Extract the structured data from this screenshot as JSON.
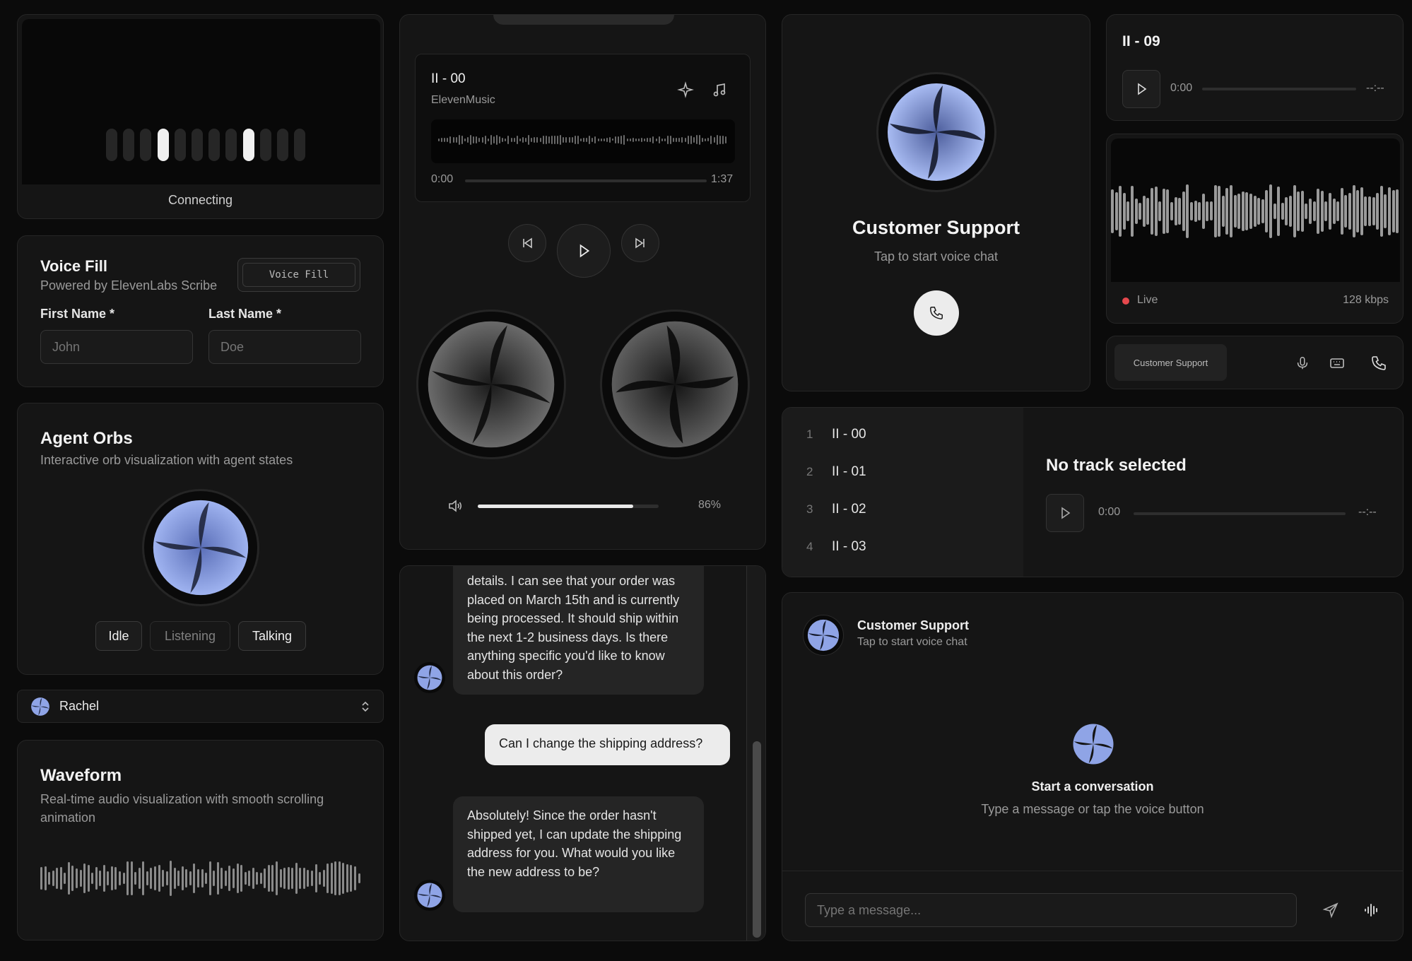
{
  "connecting": {
    "status": "Connecting",
    "bars": [
      0.8,
      0.8,
      0.8,
      0.8,
      0.8,
      0.8,
      0.8,
      0.8,
      0.8,
      0.8,
      0.8,
      0.8
    ],
    "active": [
      3,
      8
    ]
  },
  "voice_fill": {
    "title": "Voice Fill",
    "subtitle": "Powered by ElevenLabs Scribe",
    "button": "Voice Fill",
    "first_label": "First Name *",
    "first_placeholder": "John",
    "last_label": "Last Name *",
    "last_placeholder": "Doe"
  },
  "agent_orbs": {
    "title": "Agent Orbs",
    "subtitle": "Interactive orb visualization with agent states",
    "states": [
      "Idle",
      "Listening",
      "Talking"
    ]
  },
  "voice_select": {
    "value": "Rachel"
  },
  "waveform": {
    "title": "Waveform",
    "subtitle": "Real-time audio visualization with smooth scrolling animation"
  },
  "music": {
    "track": "II - 00",
    "artist": "ElevenMusic",
    "current": "0:00",
    "duration": "1:37",
    "volume_label": "86%",
    "volume": 0.86
  },
  "chat": {
    "messages": [
      {
        "role": "agent",
        "text": "details. I can see that your order was placed on March 15th and is currently being processed. It should ship within the next 1-2 business days. Is there anything specific you'd like to know about this order?"
      },
      {
        "role": "user",
        "text": "Can I change the shipping address?"
      },
      {
        "role": "agent",
        "text": "Absolutely! Since the order hasn't shipped yet, I can update the shipping address for you. What would you like the new address to be?"
      }
    ]
  },
  "support": {
    "title": "Customer Support",
    "subtitle": "Tap to start voice chat"
  },
  "mini_player": {
    "track": "II - 09",
    "current": "0:00",
    "duration": "--:--"
  },
  "live": {
    "status": "Live",
    "bitrate": "128 kbps"
  },
  "call_bar": {
    "label": "Customer Support"
  },
  "tracklist": {
    "items": [
      {
        "n": "1",
        "name": "II - 00"
      },
      {
        "n": "2",
        "name": "II - 01"
      },
      {
        "n": "3",
        "name": "II - 02"
      },
      {
        "n": "4",
        "name": "II - 03"
      }
    ],
    "empty_title": "No track selected",
    "current": "0:00",
    "duration": "--:--"
  },
  "conversation": {
    "agent_name": "Customer Support",
    "agent_sub": "Tap to start voice chat",
    "empty_title": "Start a conversation",
    "empty_sub": "Type a message or tap the voice button",
    "input_placeholder": "Type a message..."
  },
  "colors": {
    "accent": "#8fa4e6",
    "live": "#e5484d"
  }
}
